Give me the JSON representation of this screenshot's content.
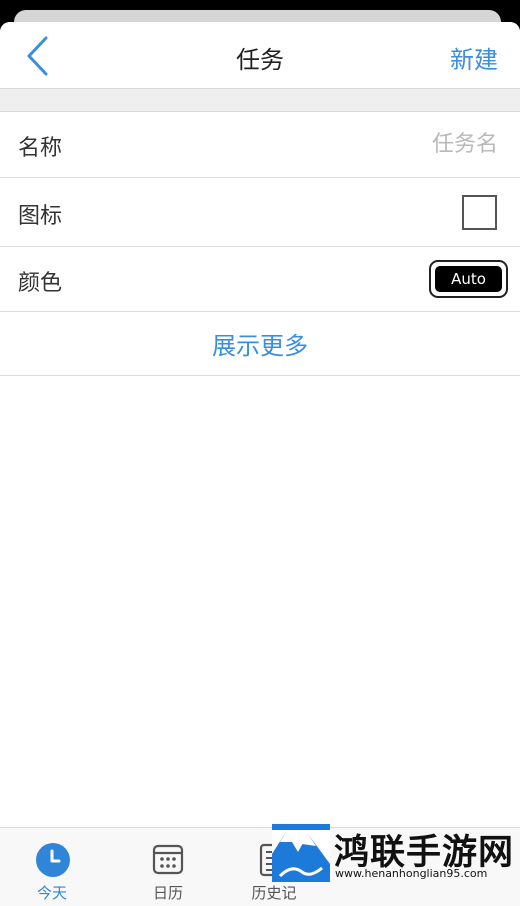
{
  "nav": {
    "title": "任务",
    "new_label": "新建"
  },
  "form": {
    "name_label": "名称",
    "name_placeholder": "任务名",
    "name_value": "",
    "icon_label": "图标",
    "color_label": "颜色",
    "color_value": "Auto",
    "show_more_label": "展示更多"
  },
  "tabs": [
    {
      "label": "今天",
      "icon": "clock-icon",
      "active": true
    },
    {
      "label": "日历",
      "icon": "calendar-icon",
      "active": false
    },
    {
      "label": "历史记",
      "icon": "history-icon",
      "active": false
    }
  ],
  "watermark": {
    "text": "鸿联手游网",
    "url": "www.henanhonglian95.com"
  },
  "colors": {
    "accent": "#3a8ee0",
    "active_tab": "#2f86d8"
  }
}
